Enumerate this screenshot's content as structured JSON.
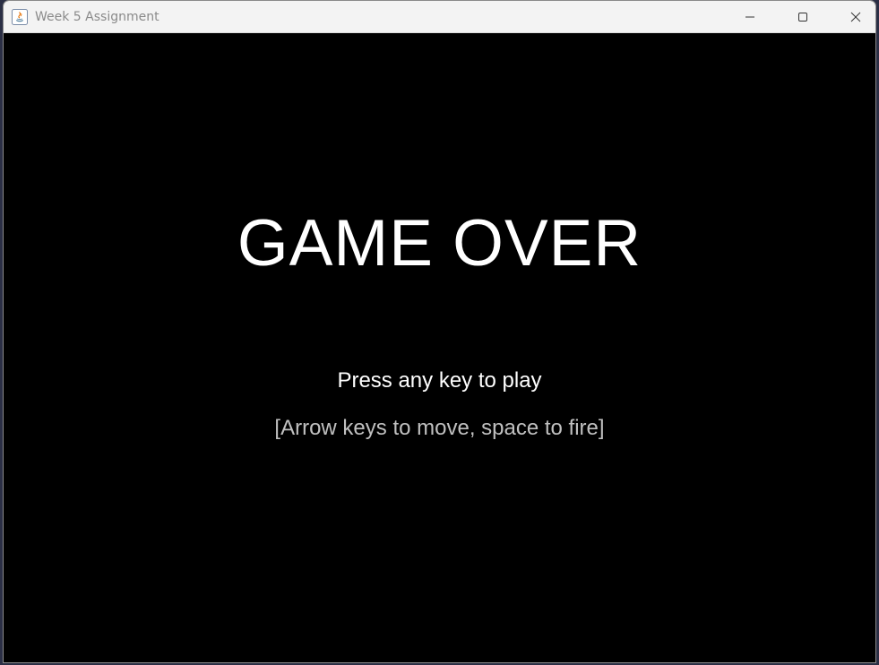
{
  "window": {
    "title": "Week 5 Assignment",
    "app_icon": "java-icon",
    "controls": {
      "minimize_icon": "minimize-icon",
      "maximize_icon": "maximize-icon",
      "close_icon": "close-icon"
    }
  },
  "game": {
    "headline": "GAME OVER",
    "prompt": "Press any key to play",
    "hint": "[Arrow keys to move, space to fire]"
  },
  "colors": {
    "canvas_background": "#000000",
    "headline": "#ffffff",
    "prompt": "#ffffff",
    "hint": "#c0c0c0",
    "titlebar": "#f3f3f3"
  }
}
